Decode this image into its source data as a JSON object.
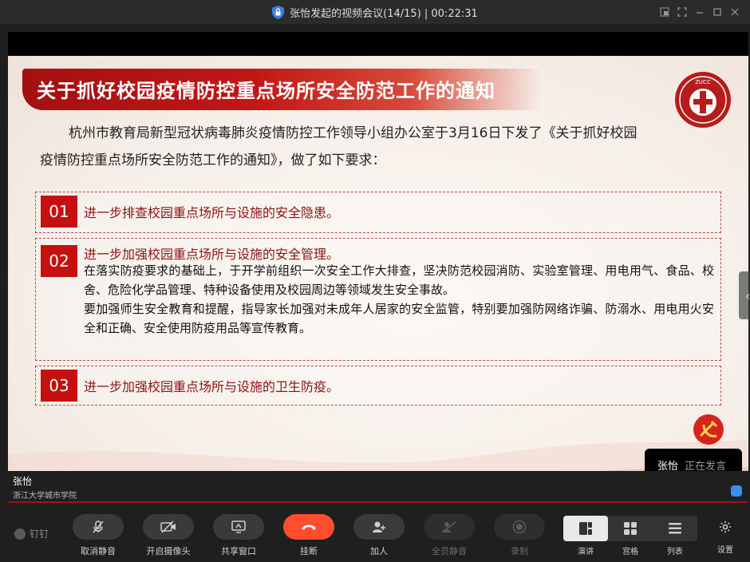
{
  "window": {
    "title": "张怡发起的视频会议(14/15) | 00:22:31"
  },
  "slide": {
    "title": "关于抓好校园疫情防控重点场所安全防范工作的通知",
    "intro_line1": "杭州市教育局新型冠状病毒肺炎疫情防控工作领导小组办公室于3月16日下发了《关于抓好校园",
    "intro_line2": "疫情防控重点场所安全防范工作的通知》，做了如下要求：",
    "items": [
      {
        "num": "01",
        "title": "进一步排查校园重点场所与设施的安全隐患。",
        "body": ""
      },
      {
        "num": "02",
        "title": "进一步加强校园重点场所与设施的安全管理。",
        "body1": "在落实防疫要求的基础上，于开学前组织一次安全工作大排查，坚决防范校园消防、实验室管理、用电用气、食品、校舍、危险化学品管理、特种设备使用及校园周边等领域发生安全事故。",
        "body2": "要加强师生安全教育和提醒，指导家长加强对未成年人居家的安全监管，特别要加强防网络诈骗、防溺水、用电用火安全和正确、安全使用防疫用品等宣传教育。"
      },
      {
        "num": "03",
        "title": "进一步加强校园重点场所与设施的卫生防疫。",
        "body": ""
      }
    ],
    "emblem_text": "ZUCC"
  },
  "speaker": {
    "name": "张怡",
    "status": "正在发言"
  },
  "nameplate": {
    "name": "张怡",
    "org": "浙江大学城市学院"
  },
  "app": {
    "logo": "钉钉"
  },
  "controls": [
    {
      "id": "unmute",
      "label": "取消静音",
      "icon": "mic-muted-icon"
    },
    {
      "id": "camera",
      "label": "开启摄像头",
      "icon": "camera-off-icon"
    },
    {
      "id": "share",
      "label": "共享窗口",
      "icon": "share-screen-icon"
    },
    {
      "id": "hangup",
      "label": "挂断",
      "icon": "hangup-icon"
    },
    {
      "id": "invite",
      "label": "加人",
      "icon": "add-person-icon"
    },
    {
      "id": "mute_all",
      "label": "全员静音",
      "icon": "mute-all-icon"
    },
    {
      "id": "record",
      "label": "录制",
      "icon": "record-icon"
    }
  ],
  "layouts": [
    {
      "id": "speaker",
      "label": "演讲",
      "active": true
    },
    {
      "id": "grid",
      "label": "宫格",
      "active": false
    },
    {
      "id": "list",
      "label": "列表",
      "active": false
    }
  ],
  "settings": {
    "label": "设置"
  },
  "colors": {
    "accent_red": "#c5100f",
    "hangup": "#ff4d2d",
    "bar_bg": "#1f1f1f"
  }
}
